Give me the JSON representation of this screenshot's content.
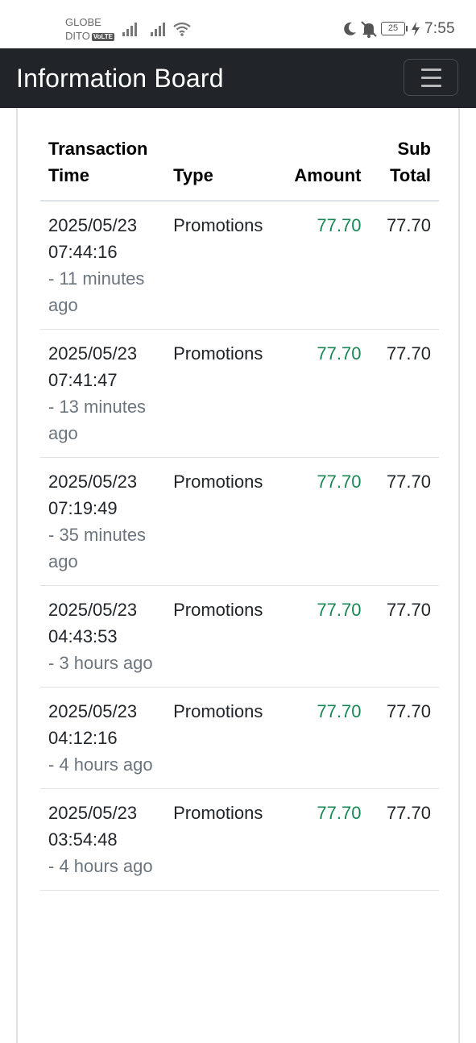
{
  "status_bar": {
    "carrier_line1": "GLOBE",
    "carrier_line2": "DITO",
    "volte_badge": "VoLTE",
    "battery": "25",
    "time": "7:55"
  },
  "navbar": {
    "title": "Information Board",
    "menu_icon": "hamburger-menu-icon"
  },
  "table": {
    "headers": {
      "time_line1": "Transaction",
      "time_line2": "Time",
      "type": "Type",
      "amount": "Amount",
      "subtotal_line1": "Sub",
      "subtotal_line2": "Total"
    },
    "rows": [
      {
        "date": "2025/05/23",
        "time": "07:44:16",
        "ago": "- 11 minutes ago",
        "type": "Promotions",
        "amount": "77.70",
        "subtotal": "77.70"
      },
      {
        "date": "2025/05/23",
        "time": "07:41:47",
        "ago": "- 13 minutes ago",
        "type": "Promotions",
        "amount": "77.70",
        "subtotal": "77.70"
      },
      {
        "date": "2025/05/23",
        "time": "07:19:49",
        "ago": "- 35 minutes ago",
        "type": "Promotions",
        "amount": "77.70",
        "subtotal": "77.70"
      },
      {
        "date": "2025/05/23",
        "time": "04:43:53",
        "ago": "- 3 hours ago",
        "type": "Promotions",
        "amount": "77.70",
        "subtotal": "77.70"
      },
      {
        "date": "2025/05/23",
        "time": "04:12:16",
        "ago": "- 4 hours ago",
        "type": "Promotions",
        "amount": "77.70",
        "subtotal": "77.70"
      },
      {
        "date": "2025/05/23",
        "time": "03:54:48",
        "ago": "- 4 hours ago",
        "type": "Promotions",
        "amount": "77.70",
        "subtotal": "77.70"
      }
    ]
  },
  "colors": {
    "navbar_bg": "#212529",
    "amount_text": "#198754",
    "muted_text": "#6c757d"
  }
}
